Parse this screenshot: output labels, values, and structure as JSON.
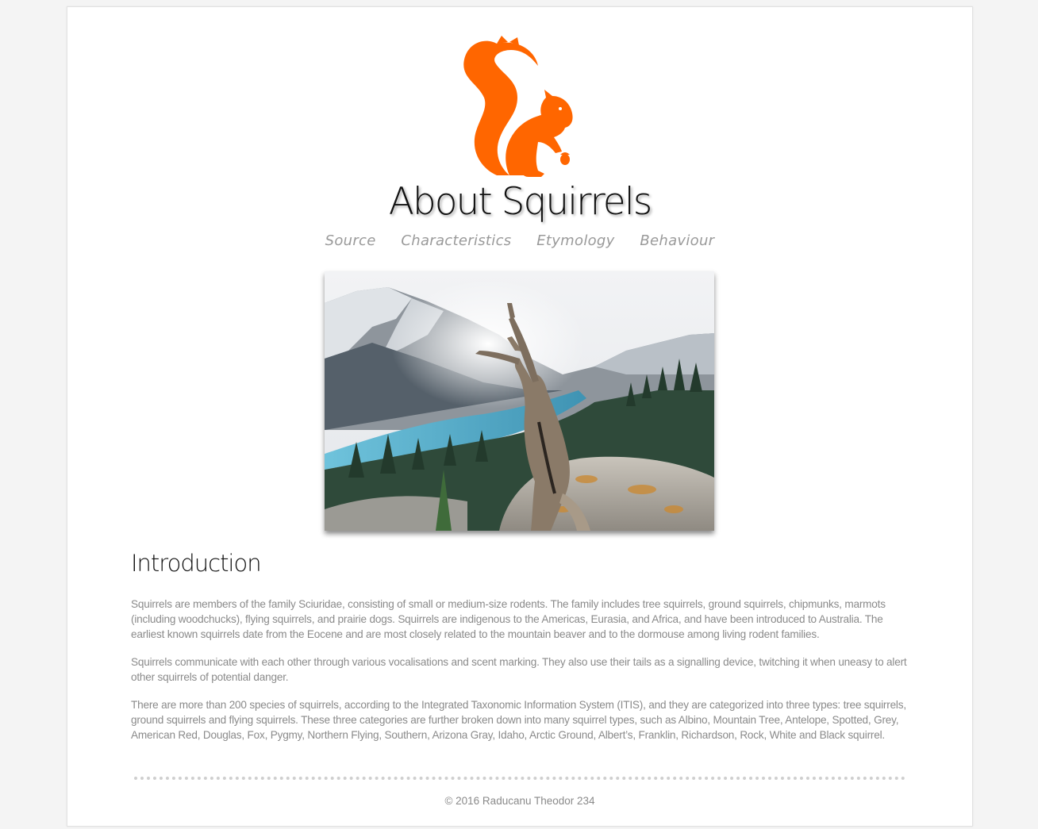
{
  "header": {
    "logo_icon": "squirrel-logo-icon",
    "title": "About Squirrels",
    "accent_color": "#ff6600"
  },
  "nav": {
    "items": [
      {
        "label": "Source"
      },
      {
        "label": "Characteristics"
      },
      {
        "label": "Etymology"
      },
      {
        "label": "Behaviour"
      }
    ]
  },
  "hero": {
    "image_name": "squirrel-mountain-photo"
  },
  "content": {
    "heading": "Introduction",
    "paragraphs": [
      "Squirrels are members of the family Sciuridae, consisting of small or medium-size rodents. The family includes tree squirrels, ground squirrels, chipmunks, marmots (including woodchucks), flying squirrels, and prairie dogs. Squirrels are indigenous to the Americas, Eurasia, and Africa, and have been introduced to Australia. The earliest known squirrels date from the Eocene and are most closely related to the mountain beaver and to the dormouse among living rodent families.",
      "Squirrels communicate with each other through various vocalisations and scent marking. They also use their tails as a signalling device, twitching it when uneasy to alert other squirrels of potential danger.",
      "There are more than 200 species of squirrels, according to the Integrated Taxonomic Information System (ITIS), and they are categorized into three types: tree squirrels, ground squirrels and flying squirrels. These three categories are further broken down into many squirrel types, such as Albino, Mountain Tree, Antelope, Spotted, Grey, American Red, Douglas, Fox, Pygmy, Northern Flying, Southern, Arizona Gray, Idaho, Arctic Ground, Albert’s, Franklin, Richardson, Rock, White and Black squirrel."
    ]
  },
  "footer": {
    "text": "© 2016 Raducanu Theodor 234"
  }
}
